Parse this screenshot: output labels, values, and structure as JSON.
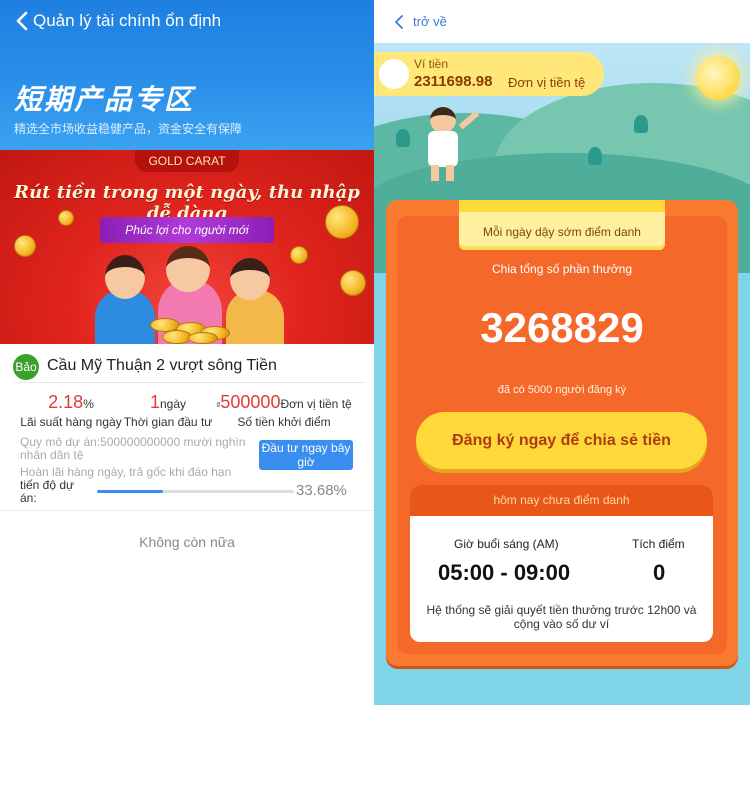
{
  "left": {
    "header": {
      "title": "Quản lý tài chính ổn định",
      "cn_title": "短期产品专区",
      "cn_subtitle": "精选全市场收益稳健产品，资金安全有保障"
    },
    "banner": {
      "tag": "GOLD CARAT",
      "headline": "Rút tiền trong một ngày, thu nhập dễ dàng",
      "ribbon": "Phúc lợi cho người mới"
    },
    "project": {
      "badge": "Bảo",
      "name": "Cầu Mỹ Thuận 2 vượt sông Tiền",
      "rate_value": "2.18",
      "rate_unit": "%",
      "rate_label": "Lãi suất hàng ngày",
      "period_value": "1",
      "period_unit": "ngày",
      "period_label": "Thời gian đầu tư",
      "min_prefix": "₫",
      "min_value": "500000",
      "min_unit": "Đơn vị tiền tệ",
      "min_label": "Số tiền khởi điểm",
      "scale_text": "Quy mô dự án:500000000000 mười nghìn nhân dân tệ",
      "repay_text": "Hoàn lãi hàng ngày, trả gốc khi đáo hạn",
      "invest_button": "Đầu tư ngay bây giờ",
      "progress_label": "tiến độ dự án:",
      "progress_text": "33.68%",
      "progress_fraction": 0.3368
    },
    "no_more": "Không còn nữa"
  },
  "right": {
    "back_text": "trở về",
    "wallet_label": "Ví tiền",
    "wallet_amount": "2311698.98",
    "wallet_unit": "Đơn vị tiền tệ",
    "tab_label": "Mỗi ngày dậy sớm điểm danh",
    "share_label": "Chia tổng số phần thưởng",
    "total_reward": "3268829",
    "registered_text": "đã có 5000 người đăng ký",
    "register_button": "Đăng ký ngay để chia sẻ tiền",
    "checkin": {
      "header": "hôm nay chưa điểm danh",
      "morning_label": "Giờ buổi sáng (AM)",
      "morning_value": "05:00 - 09:00",
      "points_label": "Tích điểm",
      "points_value": "0",
      "note": "Hệ thống sẽ giải quyết tiền thưởng trước 12h00 và cộng vào số dư ví"
    }
  },
  "colors": {
    "header_blue": "#2a8fe9",
    "accent_red": "#e03c31",
    "button_blue": "#3a8ef0",
    "card_orange": "#fa7a2f",
    "yellow": "#ffd83a"
  }
}
